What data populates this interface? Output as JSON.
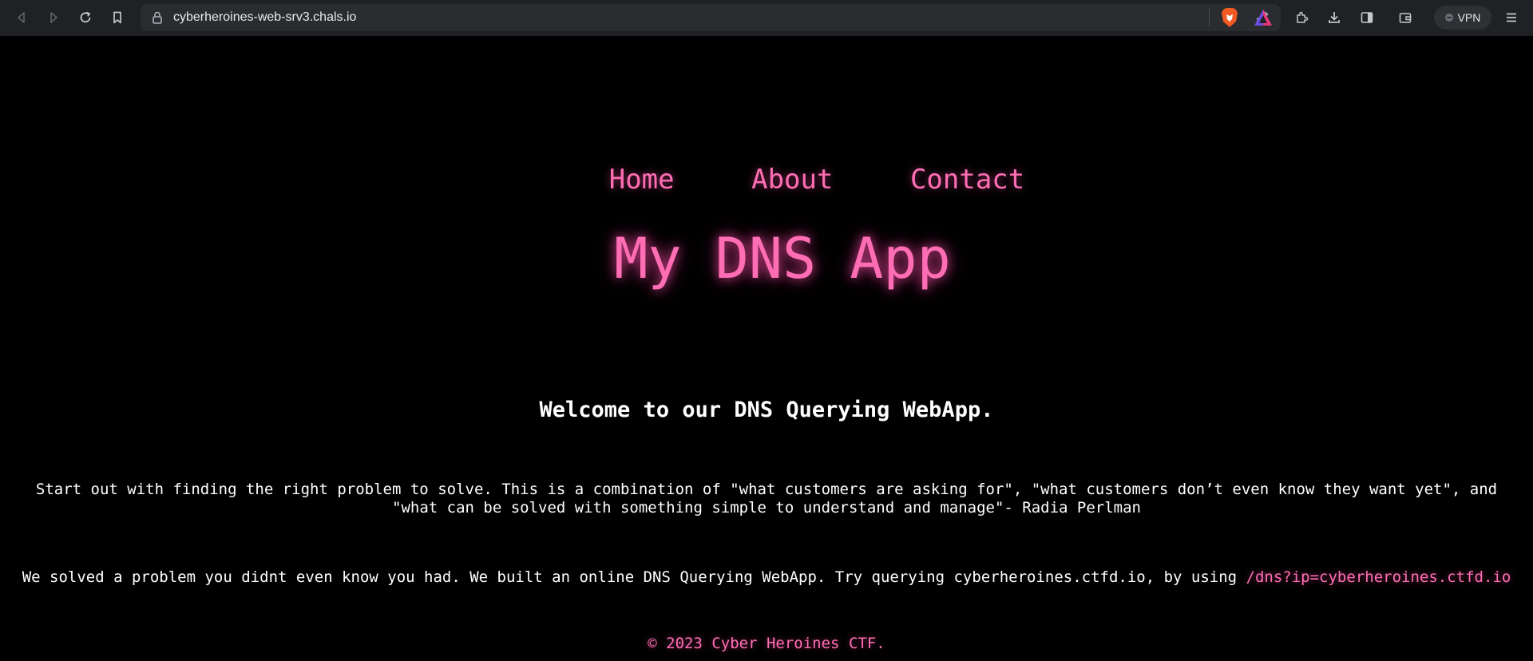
{
  "browser": {
    "url": "cyberheroines-web-srv3.chals.io",
    "vpn_label": "VPN"
  },
  "nav": {
    "items": [
      {
        "label": "Home"
      },
      {
        "label": "About"
      },
      {
        "label": "Contact"
      }
    ]
  },
  "header": {
    "title": "My DNS App"
  },
  "main": {
    "welcome": "Welcome to our DNS Querying WebApp.",
    "quote": "Start out with finding the right problem to solve. This is a combination of \"what customers are asking for\", \"what customers don’t even know they want yet\", and \"what can be solved with something simple to understand and manage\"- Radia Perlman",
    "solved_text": "We solved a problem you didnt even know you had. We built an online DNS Querying WebApp. Try querying cyberheroines.ctfd.io, by using ",
    "solved_link": "/dns?ip=cyberheroines.ctfd.io"
  },
  "footer": {
    "copyright": "© 2023 Cyber Heroines CTF."
  },
  "colors": {
    "accent": "#ff6eb4",
    "background": "#000000",
    "text": "#ffffff"
  }
}
